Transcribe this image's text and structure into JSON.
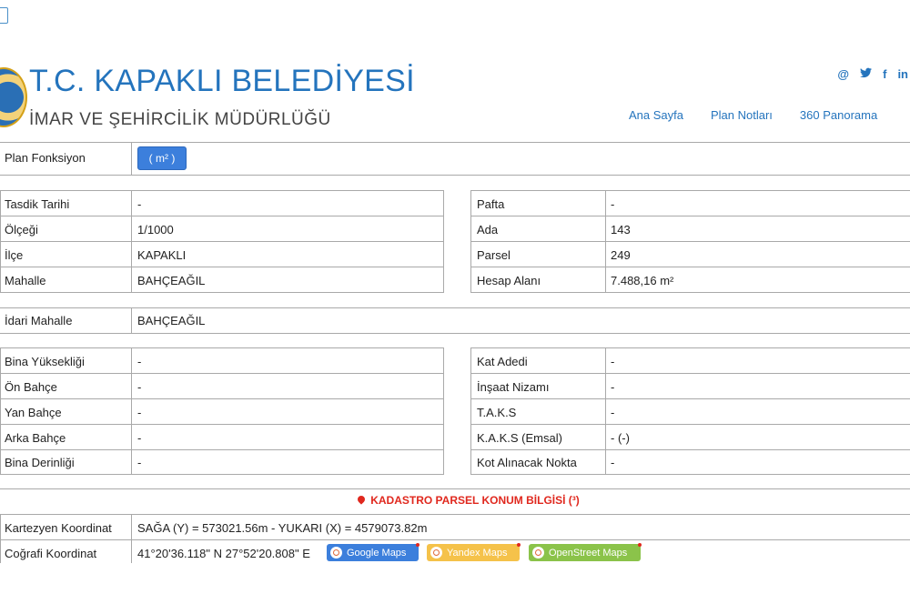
{
  "header": {
    "title": "T.C. KAPAKLI BELEDİYESİ",
    "subtitle": "İMAR VE ŞEHİRCİLİK MÜDÜRLÜĞÜ",
    "social": [
      "@",
      "🐦",
      "f",
      "in"
    ],
    "nav": [
      "Ana Sayfa",
      "Plan Notları",
      "360 Panorama"
    ]
  },
  "plan": {
    "label": "Plan Fonksiyon",
    "button": "( m² )"
  },
  "info_left": [
    {
      "label": "Tasdik Tarihi",
      "value": "-"
    },
    {
      "label": "Ölçeği",
      "value": "1/1000"
    },
    {
      "label": "İlçe",
      "value": "KAPAKLI"
    },
    {
      "label": "Mahalle",
      "value": "BAHÇEAĞIL"
    }
  ],
  "info_right": [
    {
      "label": "Pafta",
      "value": "-"
    },
    {
      "label": "Ada",
      "value": "143"
    },
    {
      "label": "Parsel",
      "value": "249"
    },
    {
      "label": "Hesap Alanı",
      "value": "7.488,16 m²"
    }
  ],
  "idari": {
    "label": "İdari Mahalle",
    "value": "BAHÇEAĞIL"
  },
  "build_left": [
    {
      "label": "Bina Yüksekliği",
      "value": "-"
    },
    {
      "label": "Ön Bahçe",
      "value": "-"
    },
    {
      "label": "Yan Bahçe",
      "value": "-"
    },
    {
      "label": "Arka Bahçe",
      "value": "-"
    },
    {
      "label": "Bina Derinliği",
      "value": "-"
    }
  ],
  "build_right": [
    {
      "label": "Kat Adedi",
      "value": "-"
    },
    {
      "label": "İnşaat Nizamı",
      "value": "-"
    },
    {
      "label": "T.A.K.S",
      "value": "-"
    },
    {
      "label": "K.A.K.S (Emsal)",
      "value": "- (-)"
    },
    {
      "label": "Kot Alınacak Nokta",
      "value": "-"
    }
  ],
  "kadastro": {
    "title": "KADASTRO PARSEL KONUM BİLGİSİ (³)",
    "kartezyen_label": "Kartezyen Koordinat",
    "kartezyen_value": "SAĞA (Y) = 573021.56m - YUKARI (X) = 4579073.82m",
    "cografi_label": "Coğrafi Koordinat",
    "cografi_value": "41°20'36.118\" N 27°52'20.808\" E",
    "maps": [
      {
        "label": "Google Maps",
        "color": "#3c7fdc"
      },
      {
        "label": "Yandex Maps",
        "color": "#f5c24a"
      },
      {
        "label": "OpenStreet Maps",
        "color": "#8bc34a"
      }
    ]
  }
}
